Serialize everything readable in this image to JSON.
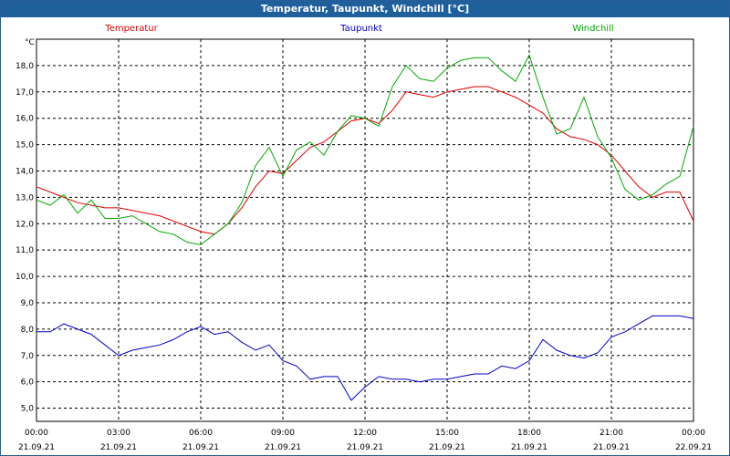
{
  "window": {
    "title": "Temperatur, Taupunkt, Windchill [°C]"
  },
  "chart_data": {
    "type": "line",
    "title": "Temperatur, Taupunkt, Windchill [°C]",
    "ylabel": "°C",
    "ylim": [
      4.5,
      19.0
    ],
    "yticks": [
      "5,0",
      "6,0",
      "7,0",
      "8,0",
      "9,0",
      "10,0",
      "11,0",
      "12,0",
      "13,0",
      "14,0",
      "15,0",
      "16,0",
      "17,0",
      "18,0"
    ],
    "xticks": [
      {
        "time": "00:00",
        "date": "21.09.21"
      },
      {
        "time": "03:00",
        "date": "21.09.21"
      },
      {
        "time": "06:00",
        "date": "21.09.21"
      },
      {
        "time": "09:00",
        "date": "21.09.21"
      },
      {
        "time": "12:00",
        "date": "21.09.21"
      },
      {
        "time": "15:00",
        "date": "21.09.21"
      },
      {
        "time": "18:00",
        "date": "21.09.21"
      },
      {
        "time": "21:00",
        "date": "21.09.21"
      },
      {
        "time": "00:00",
        "date": "22.09.21"
      }
    ],
    "grid": true,
    "legend_position": "top",
    "series": [
      {
        "name": "Temperatur",
        "color": "#e00000",
        "x": [
          0,
          0.5,
          1,
          1.5,
          2,
          2.5,
          3,
          3.5,
          4,
          4.5,
          5,
          5.5,
          6,
          6.5,
          7,
          7.5,
          8,
          8.5,
          9,
          9.5,
          10,
          10.5,
          11,
          11.5,
          12,
          12.5,
          13,
          13.5,
          14,
          14.5,
          15,
          15.5,
          16,
          16.5,
          17,
          17.5,
          18,
          18.5,
          19,
          19.5,
          20,
          20.5,
          21,
          21.5,
          22,
          22.5,
          23,
          23.5,
          24
        ],
        "values": [
          13.4,
          13.2,
          13.0,
          12.8,
          12.7,
          12.6,
          12.6,
          12.5,
          12.4,
          12.3,
          12.1,
          11.9,
          11.7,
          11.6,
          12.0,
          12.6,
          13.4,
          14.0,
          13.9,
          14.4,
          14.9,
          15.1,
          15.5,
          15.9,
          16.0,
          15.8,
          16.3,
          17.0,
          16.9,
          16.8,
          17.0,
          17.1,
          17.2,
          17.2,
          17.0,
          16.8,
          16.5,
          16.2,
          15.6,
          15.3,
          15.2,
          15.0,
          14.6,
          14.0,
          13.4,
          13.0,
          13.2,
          13.2,
          12.1
        ]
      },
      {
        "name": "Taupunkt",
        "color": "#0000cc",
        "x": [
          0,
          0.5,
          1,
          1.5,
          2,
          2.5,
          3,
          3.5,
          4,
          4.5,
          5,
          5.5,
          6,
          6.5,
          7,
          7.5,
          8,
          8.5,
          9,
          9.5,
          10,
          10.5,
          11,
          11.5,
          12,
          12.5,
          13,
          13.5,
          14,
          14.5,
          15,
          15.5,
          16,
          16.5,
          17,
          17.5,
          18,
          18.5,
          19,
          19.5,
          20,
          20.5,
          21,
          21.5,
          22,
          22.5,
          23,
          23.5,
          24
        ],
        "values": [
          7.9,
          7.9,
          8.2,
          8.0,
          7.8,
          7.4,
          7.0,
          7.2,
          7.3,
          7.4,
          7.6,
          7.9,
          8.1,
          7.8,
          7.9,
          7.5,
          7.2,
          7.4,
          6.8,
          6.6,
          6.1,
          6.2,
          6.2,
          5.3,
          5.8,
          6.2,
          6.1,
          6.1,
          6.0,
          6.1,
          6.1,
          6.2,
          6.3,
          6.3,
          6.6,
          6.5,
          6.8,
          7.6,
          7.2,
          7.0,
          6.9,
          7.1,
          7.7,
          7.9,
          8.2,
          8.5,
          8.5,
          8.5,
          8.4
        ]
      },
      {
        "name": "Windchill",
        "color": "#00aa00",
        "x": [
          0,
          0.5,
          1,
          1.5,
          2,
          2.5,
          3,
          3.5,
          4,
          4.5,
          5,
          5.5,
          6,
          6.5,
          7,
          7.5,
          8,
          8.5,
          9,
          9.5,
          10,
          10.5,
          11,
          11.5,
          12,
          12.5,
          13,
          13.5,
          14,
          14.5,
          15,
          15.5,
          16,
          16.5,
          17,
          17.5,
          18,
          18.5,
          19,
          19.5,
          20,
          20.5,
          21,
          21.5,
          22,
          22.5,
          23,
          23.5,
          24
        ],
        "values": [
          12.9,
          12.7,
          13.1,
          12.4,
          12.9,
          12.2,
          12.2,
          12.3,
          12.0,
          11.7,
          11.6,
          11.3,
          11.2,
          11.6,
          12.0,
          12.8,
          14.2,
          14.9,
          13.8,
          14.8,
          15.1,
          14.6,
          15.5,
          16.1,
          16.0,
          15.7,
          17.2,
          18.0,
          17.5,
          17.4,
          17.9,
          18.2,
          18.3,
          18.3,
          17.8,
          17.4,
          18.4,
          16.8,
          15.4,
          15.6,
          16.8,
          15.3,
          14.5,
          13.3,
          12.9,
          13.1,
          13.5,
          13.8,
          15.7
        ]
      }
    ]
  }
}
